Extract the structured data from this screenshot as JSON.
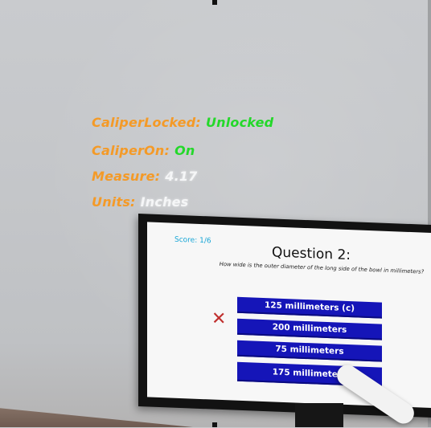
{
  "hud": {
    "caliper_locked_label": "CaliperLocked:",
    "caliper_locked_value": "Unlocked",
    "caliper_on_label": "CaliperOn:",
    "caliper_on_value": "On",
    "measure_label": "Measure:",
    "measure_value": "4.17",
    "units_label": "Units:",
    "units_value": "Inches"
  },
  "quiz": {
    "score": "Score: 1/6",
    "title": "Question 2:",
    "question": "How wide is the outer diameter of the long side of the bowl in millimeters?",
    "answers": [
      "125 millimeters (c)",
      "200 millimeters",
      "75 millimeters",
      "175 millimeters"
    ],
    "wrong_mark": "✕"
  },
  "colors": {
    "label_orange": "#f49a27",
    "value_green": "#24d82a",
    "answer_blue": "#1515b8",
    "score_cyan": "#18a6d6",
    "wrong_red": "#c0302e"
  }
}
